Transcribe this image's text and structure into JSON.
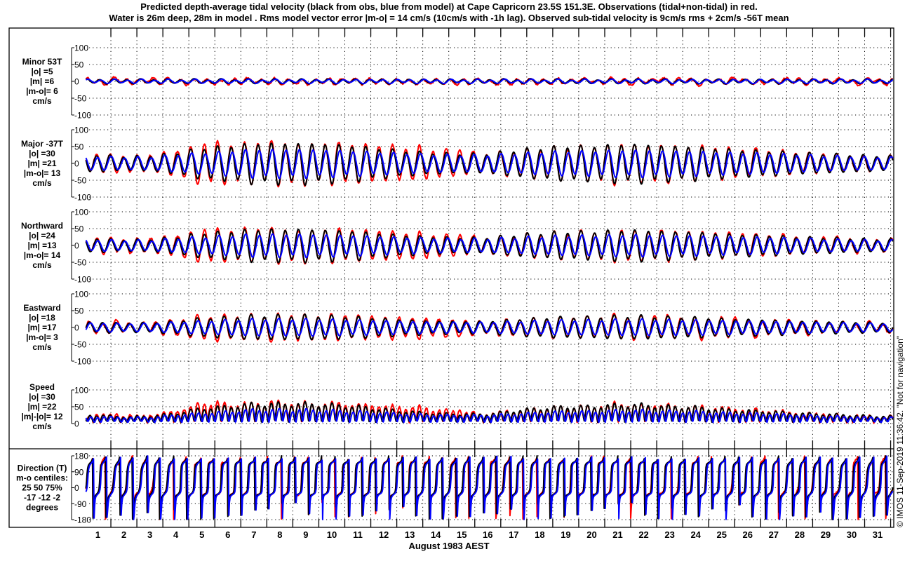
{
  "chart_data": {
    "type": "line",
    "title": [
      "Predicted depth-average tidal velocity (black from obs, blue from model) at Cape Capricorn 23.5S 151.3E. Observations (tidal+non-tidal) in red.",
      "Water is 26m deep, 28m in model . Rms model vector error |m-o| = 14 cm/s (10cm/s with -1h lag). Observed sub-tidal velocity is 9cm/s rms + 2cm/s -56T mean"
    ],
    "xlabel": "August 1983 AEST",
    "x_ticks": [
      "1",
      "2",
      "3",
      "4",
      "5",
      "6",
      "7",
      "8",
      "9",
      "10",
      "11",
      "12",
      "13",
      "14",
      "15",
      "16",
      "17",
      "18",
      "19",
      "20",
      "21",
      "22",
      "23",
      "24",
      "25",
      "26",
      "27",
      "28",
      "29",
      "30",
      "31"
    ],
    "x_range_days": [
      1,
      32.1
    ],
    "grid": true,
    "series": [
      {
        "name": "observations (tidal+non-tidal)",
        "color": "#ff0000"
      },
      {
        "name": "tidal from obs",
        "color": "#000000"
      },
      {
        "name": "tidal from model",
        "color": "#0000ff"
      }
    ],
    "tidal_period_hours": 12.42,
    "major_axis_deg_true": -37,
    "minor_axis_deg_true": 53,
    "daily_major_amplitude_cms": {
      "observed": [
        27,
        22,
        25,
        35,
        60,
        55,
        62,
        60,
        58,
        62,
        55,
        50,
        48,
        42,
        38,
        30,
        36,
        45,
        50,
        50,
        55,
        55,
        52,
        48,
        44,
        40,
        36,
        32,
        28,
        26,
        22
      ],
      "obs_tidal": [
        25,
        20,
        22,
        30,
        45,
        50,
        58,
        58,
        58,
        55,
        50,
        42,
        35,
        30,
        28,
        28,
        38,
        45,
        50,
        50,
        55,
        55,
        50,
        48,
        42,
        38,
        35,
        30,
        28,
        25,
        22
      ],
      "model": [
        20,
        18,
        18,
        25,
        30,
        35,
        40,
        40,
        40,
        38,
        35,
        32,
        28,
        25,
        24,
        24,
        28,
        32,
        35,
        35,
        38,
        38,
        36,
        35,
        32,
        30,
        28,
        25,
        22,
        20,
        18
      ]
    },
    "minor_amplitude_cms": {
      "observed": 7,
      "obs_tidal": 6,
      "model": 5
    },
    "panels": [
      {
        "id": "minor",
        "label": [
          "Minor 53T",
          "|o| =5",
          "|m| =6",
          "|m-o|= 6",
          "cm/s"
        ],
        "yticks": [
          "100",
          "50",
          "0",
          "-50",
          "-100"
        ],
        "ylim": [
          -100,
          100
        ]
      },
      {
        "id": "major",
        "label": [
          "Major -37T",
          "|o| =30",
          "|m| =21",
          "|m-o|= 13",
          "cm/s"
        ],
        "yticks": [
          "100",
          "50",
          "0",
          "-50",
          "-100"
        ],
        "ylim": [
          -100,
          100
        ]
      },
      {
        "id": "north",
        "label": [
          "Northward",
          "|o| =24",
          "|m| =13",
          "|m-o|= 14",
          "cm/s"
        ],
        "yticks": [
          "100",
          "50",
          "0",
          "-50",
          "-100"
        ],
        "ylim": [
          -100,
          100
        ]
      },
      {
        "id": "east",
        "label": [
          "Eastward",
          "|o| =18",
          "|m| =17",
          "|m-o|= 3",
          "cm/s"
        ],
        "yticks": [
          "100",
          "50",
          "0",
          "-50",
          "-100"
        ],
        "ylim": [
          -100,
          100
        ]
      },
      {
        "id": "speed",
        "label": [
          "Speed",
          "|o| =30",
          "|m| =22",
          "|m|-|o|= 12",
          "cm/s"
        ],
        "yticks": [
          "100",
          "50",
          "0"
        ],
        "ylim": [
          0,
          100
        ]
      },
      {
        "id": "direction",
        "label": [
          "Direction (T)",
          "m-o centiles:",
          "25  50  75%",
          "-17 -12  -2",
          "degrees"
        ],
        "yticks": [
          "180",
          "90",
          "0",
          "-90",
          "-180"
        ],
        "ylim": [
          -180,
          180
        ]
      }
    ],
    "credit": "© IMOS 11-Sep-2019 11:36:42. \"Not for navigation\""
  }
}
